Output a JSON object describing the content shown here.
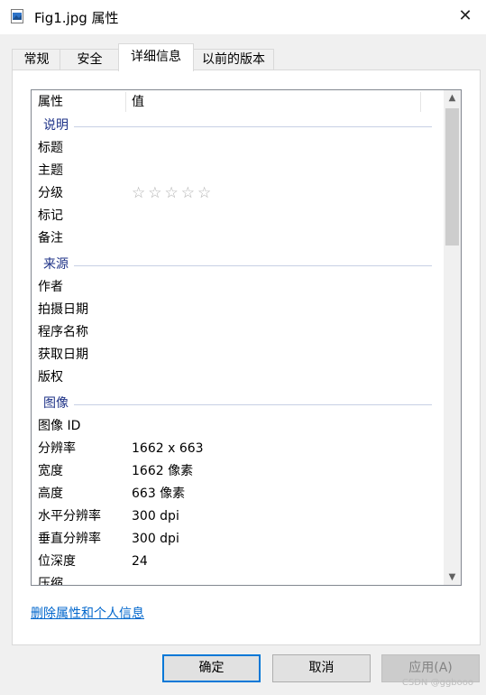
{
  "window": {
    "title": "Fig1.jpg 属性"
  },
  "tabs": [
    "常规",
    "安全",
    "详细信息",
    "以前的版本"
  ],
  "active_tab": "详细信息",
  "columns": {
    "name": "属性",
    "value": "值"
  },
  "groups": {
    "description": {
      "label": "说明",
      "rows": [
        {
          "name": "标题",
          "value": ""
        },
        {
          "name": "主题",
          "value": ""
        },
        {
          "name": "分级",
          "value": "",
          "rating": 0,
          "rating_max": 5
        },
        {
          "name": "标记",
          "value": ""
        },
        {
          "name": "备注",
          "value": ""
        }
      ]
    },
    "origin": {
      "label": "来源",
      "rows": [
        {
          "name": "作者",
          "value": ""
        },
        {
          "name": "拍摄日期",
          "value": ""
        },
        {
          "name": "程序名称",
          "value": ""
        },
        {
          "name": "获取日期",
          "value": ""
        },
        {
          "name": "版权",
          "value": ""
        }
      ]
    },
    "image": {
      "label": "图像",
      "rows": [
        {
          "name": "图像 ID",
          "value": ""
        },
        {
          "name": "分辨率",
          "value": "1662 x 663"
        },
        {
          "name": "宽度",
          "value": "1662 像素"
        },
        {
          "name": "高度",
          "value": "663 像素"
        },
        {
          "name": "水平分辨率",
          "value": "300 dpi"
        },
        {
          "name": "垂直分辨率",
          "value": "300 dpi"
        },
        {
          "name": "位深度",
          "value": "24"
        },
        {
          "name": "压缩",
          "value": ""
        }
      ]
    }
  },
  "remove_link": "删除属性和个人信息",
  "buttons": {
    "ok": "确定",
    "cancel": "取消",
    "apply": "应用(A)"
  },
  "icons": {
    "file": "image-file-icon",
    "close": "close-icon",
    "up": "scroll-up-icon",
    "down": "scroll-down-icon",
    "star": "star-icon"
  },
  "watermark": "CSDN @ggbooo"
}
